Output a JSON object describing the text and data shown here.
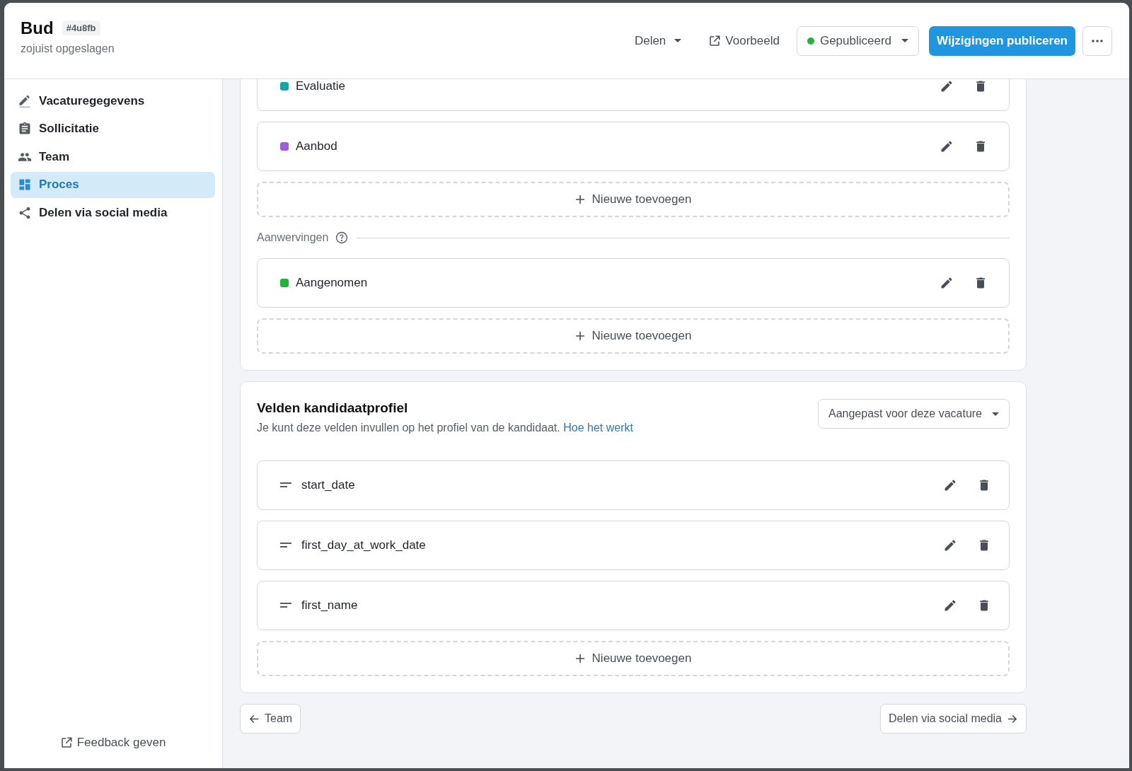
{
  "header": {
    "title": "Bud",
    "id_badge": "#4u8fb",
    "save_status": "zojuist opgeslagen",
    "share_label": "Delen",
    "preview_label": "Voorbeeld",
    "status": {
      "label": "Gepubliceerd",
      "color": "#22b33a"
    },
    "publish_label": "Wijzigingen publiceren"
  },
  "sidebar": {
    "items": [
      {
        "label": "Vacaturegegevens",
        "selected": false
      },
      {
        "label": "Sollicitatie",
        "selected": false
      },
      {
        "label": "Team",
        "selected": false
      },
      {
        "label": "Proces",
        "selected": true
      },
      {
        "label": "Delen via social media",
        "selected": false
      }
    ],
    "feedback_label": "Feedback geven"
  },
  "stage_groups": [
    {
      "stages": [
        {
          "name": "Evaluatie",
          "color": "#14a6a8"
        },
        {
          "name": "Aanbod",
          "color": "#a05de0"
        }
      ],
      "add_label": "Nieuwe toevoegen"
    },
    {
      "heading": "Aanwervingen",
      "stages": [
        {
          "name": "Aangenomen",
          "color": "#22b33a"
        }
      ],
      "add_label": "Nieuwe toevoegen"
    }
  ],
  "profile_fields": {
    "title": "Velden kandidaatprofiel",
    "description": "Je kunt deze velden invullen op het profiel van de kandidaat.",
    "link": "Hoe het werkt",
    "scope": "Aangepast voor deze vacature",
    "fields": [
      {
        "name": "start_date"
      },
      {
        "name": "first_day_at_work_date"
      },
      {
        "name": "first_name"
      }
    ],
    "add_label": "Nieuwe toevoegen"
  },
  "navigation": {
    "back": "Team",
    "next": "Delen via social media"
  }
}
